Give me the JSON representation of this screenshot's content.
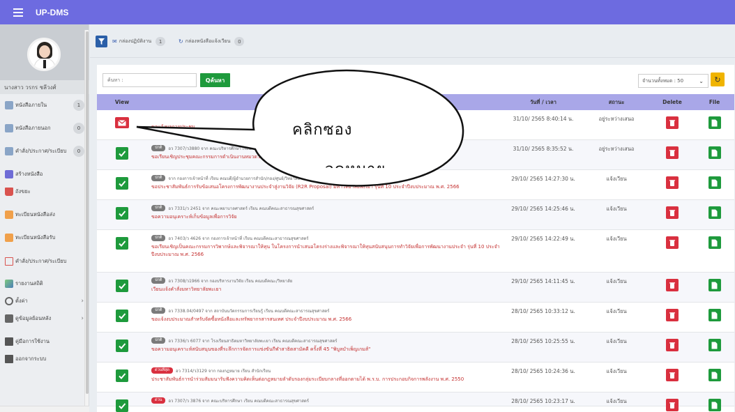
{
  "app": {
    "title": "UP-DMS"
  },
  "profile": {
    "name": "นางสาว วรกร ชลีวงศ์"
  },
  "sidebar": {
    "items": [
      {
        "label": "หนังสือภายใน",
        "count": "1",
        "icon": "document-icon"
      },
      {
        "label": "หนังสือภายนอก",
        "count": "0",
        "icon": "document-icon"
      },
      {
        "label": "คำสั่ง/ประกาศ/ระเบียบ",
        "count": "0",
        "icon": "document-icon"
      },
      {
        "label": "สร้างหนังสือ",
        "icon": "create-document-icon"
      },
      {
        "label": "ถังขยะ",
        "icon": "trash-icon"
      },
      {
        "label": "ทะเบียนหนังสือส่ง",
        "icon": "register-send-icon"
      },
      {
        "label": "ทะเบียนหนังสือรับ",
        "icon": "register-receive-icon"
      },
      {
        "label": "คำสั่ง/ประกาศ/ระเบียบ",
        "icon": "book-icon"
      },
      {
        "label": "รายงานสถิติ",
        "icon": "chart-icon"
      },
      {
        "label": "ตั้งค่า",
        "icon": "gear-icon"
      },
      {
        "label": "ดูข้อมูลย้อนหลัง",
        "icon": "layers-icon"
      },
      {
        "label": "คู่มือการใช้งาน",
        "icon": "manual-icon"
      },
      {
        "label": "ออกจากระบบ",
        "icon": "logout-icon"
      }
    ]
  },
  "toolbar": {
    "inbox_label": "กล่องปฏิบัติงาน",
    "inbox_count": "1",
    "notify_label": "กล่องหนังสือแจ้งเวียน",
    "notify_count": "0"
  },
  "search": {
    "placeholder": "ค้นหา :",
    "button_label": "Qค้นหา"
  },
  "pagination": {
    "page_size_label": "จำนวนทั้งหมด : 50"
  },
  "table": {
    "headers": {
      "view": "View",
      "subject": "",
      "date": "วันที่ / เวลา",
      "status": "สถานะ",
      "delete": "Delete",
      "file": "File"
    },
    "rows": [
      {
        "view": "envelope",
        "tag": "",
        "meta": "",
        "subject": "ขอแจ้งผลการประชุม",
        "date": "31/10/ 2565 8:40:14 น.",
        "status": "อยู่ระหว่างเสนอ"
      },
      {
        "view": "check",
        "tag": "ปกติ",
        "meta": "อว 7307/ว3880 จาก คณะบริหารศึกษา เรียน",
        "subject": "ขอเรียนเชิญประชุมคณะกรรมการดำเนินงานหมวดวิชา",
        "date": "31/10/ 2565 8:35:52 น.",
        "status": "อยู่ระหว่างเสนอ"
      },
      {
        "view": "check",
        "tag": "ปกติ",
        "meta": "จาก กองการเจ้าหน้าที่ เรียน คณบดี/ผู้อำนวยการสำนัก/กอง/ศูนย์/วิทยาลัย",
        "subject": "ขอประชาสัมพันธ์การรับข้อเสนอโครงการพัฒนางานประจำสู่งานวิจัย (R2R Proposal) มหาวิทยาลัยพะเยา รุ่นที่ 10 ประจำปีงบประมาณ พ.ศ. 2566",
        "date": "29/10/ 2565 14:27:30 น.",
        "status": "แจ้งเวียน"
      },
      {
        "view": "check",
        "tag": "ปกติ",
        "meta": "อว 7331/ว 2451 จาก คณะพยาบาลศาสตร์ เรียน คณบดีคณะสาธารณสุขศาสตร์",
        "subject": "ขอความอนุเคราะห์เก็บข้อมูลเพื่อการวิจัย",
        "date": "29/10/ 2565 14:25:46 น.",
        "status": "แจ้งเวียน"
      },
      {
        "view": "check",
        "tag": "ปกติ",
        "meta": "อว 7403/ว 4626 จาก กองการเจ้าหน้าที่ เรียน คณบดีคณะสาธารณสุขศาสตร์",
        "subject": "ขอเรียนเชิญเป็นคณะกรรมการวิพากษ์และพิจารณาให้ทุน ในโครงการนำเสนอโครงร่างและพิจารณาให้ทุนสนับสนุนการทำวิจัยเพื่อการพัฒนางานประจำ รุ่นที่ 10 ประจำปีงบประมาณ พ.ศ. 2566",
        "date": "29/10/ 2565 14:22:49 น.",
        "status": "แจ้งเวียน"
      },
      {
        "view": "check",
        "tag": "ปกติ",
        "meta": "อว 7308/ว1966 จาก กองบริหารงานวิจัย เรียน คณบดีคณะ/วิทยาลัย",
        "subject": "เวียนแจ้งคำสั่งมหาวิทยาลัยพะเยา",
        "date": "29/10/ 2565 14:11:45 น.",
        "status": "แจ้งเวียน"
      },
      {
        "view": "check",
        "tag": "ปกติ",
        "meta": "อว 7338.04/0497 จาก สถาบันนวัตกรรมการเรียนรู้ เรียน คณบดีคณะสาธารณสุขศาสตร์",
        "subject": "ขอแจ้งงบประมาณสำหรับจัดซื้อหนังสือและทรัพยากรสารสนเทศ ประจำปีงบประมาณ พ.ศ. 2566",
        "date": "28/10/ 2565 10:33:12 น.",
        "status": "แจ้งเวียน"
      },
      {
        "view": "check",
        "tag": "ปกติ",
        "meta": "อว 7336/ว 6077 จาก โรงเรียนสาธิตมหาวิทยาลัยพะเยา เรียน คณบดีคณะสาธารณสุขศาสตร์",
        "subject": "ขอความอนุเคราะห์สนับสนุนของที่ระลึกการจัดการแข่งขันกีฬาสาธิตสามัคคี ครั้งที่ 45 \"พิบูลบำเพ็ญเกมส์\"",
        "date": "28/10/ 2565 10:25:55 น.",
        "status": "แจ้งเวียน"
      },
      {
        "view": "check",
        "tag": "ด่วนที่สุด",
        "tag_red": true,
        "meta": "อว 7314/ว3129 จาก กองกฎหมาย เรียน สำนักเรียน",
        "subject": "ประชาสัมพันธ์การนำร่วมสัมมนารับฟังความคิดเห็นต่อกฎหมายลำดับรองกลุ่มระเบียบกลางที่ออกตามได้ พ.ร.บ. การประกอบกิจการพลังงาน พ.ศ. 2550",
        "date": "28/10/ 2565 10:24:36 น.",
        "status": "แจ้งเวียน"
      },
      {
        "view": "check",
        "tag": "ด่วน",
        "tag_red": true,
        "meta": "อว 7307/ว 3876 จาก คณะบริหารศึกษา เรียน คณบดีคณะสาธารณสุขศาสตร์",
        "subject": "",
        "date": "28/10/ 2565 10:23:17 น.",
        "status": "แจ้งเวียน"
      }
    ]
  },
  "callout": {
    "text": "คลิกซอง",
    "text_overflow": "จดหมาย"
  }
}
